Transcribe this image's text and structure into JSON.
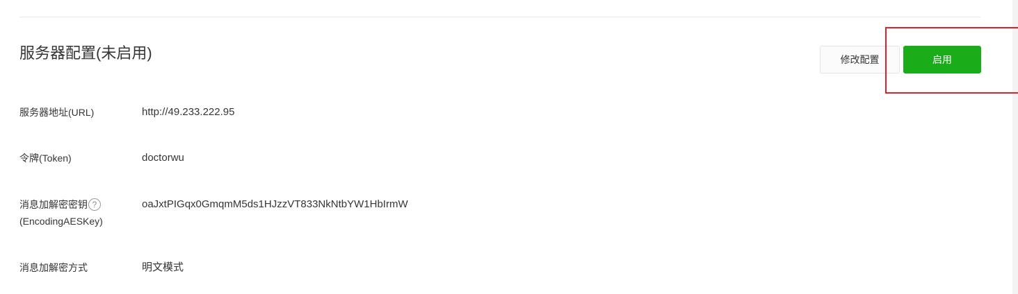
{
  "section": {
    "title": "服务器配置(未启用)"
  },
  "actions": {
    "modify_label": "修改配置",
    "enable_label": "启用"
  },
  "rows": {
    "url": {
      "label": "服务器地址(URL)",
      "value": "http://49.233.222.95"
    },
    "token": {
      "label": "令牌(Token)",
      "value": "doctorwu"
    },
    "aes_key": {
      "label_line1": "消息加解密密钥",
      "label_line2": "(EncodingAESKey)",
      "help_glyph": "?",
      "value": "oaJxtPIGqx0GmqmM5ds1HJzzVT833NkNtbYW1HbIrmW"
    },
    "encrypt_mode": {
      "label": "消息加解密方式",
      "value": "明文模式"
    }
  },
  "colors": {
    "accent_green": "#1aad19",
    "highlight_red": "#e01f2b"
  },
  "icons": {
    "help": "question-circle-icon"
  }
}
